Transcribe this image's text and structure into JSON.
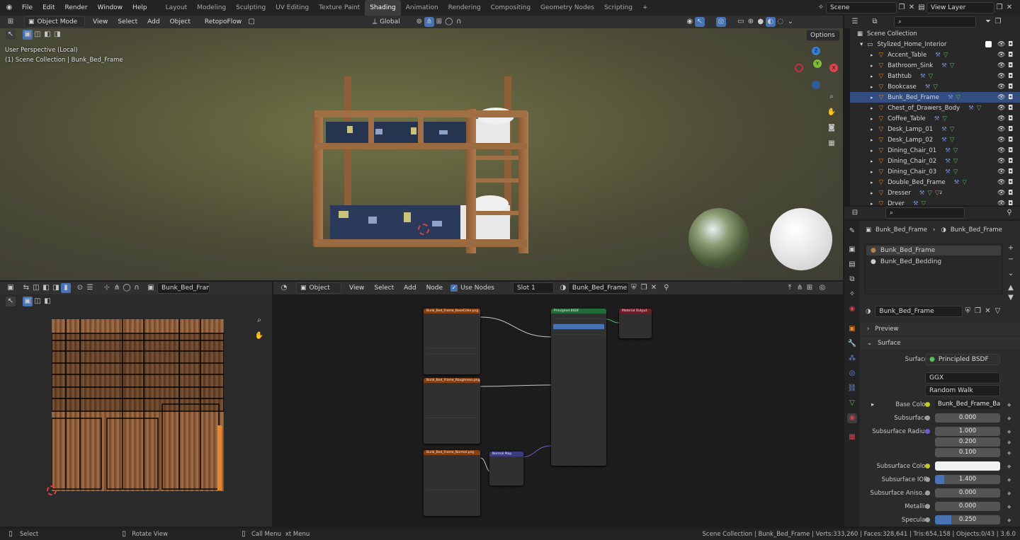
{
  "menu": [
    "File",
    "Edit",
    "Render",
    "Window",
    "Help"
  ],
  "workspaces": [
    "Layout",
    "Modeling",
    "Sculpting",
    "UV Editing",
    "Texture Paint",
    "Shading",
    "Animation",
    "Rendering",
    "Compositing",
    "Geometry Nodes",
    "Scripting"
  ],
  "active_workspace": "Shading",
  "scene": "Scene",
  "view_layer": "View Layer",
  "viewport_header": {
    "mode": "Object Mode",
    "menus": [
      "View",
      "Select",
      "Add",
      "Object"
    ],
    "addon": "RetopoFlow",
    "transform": "Global",
    "options": "Options"
  },
  "viewport_overlay": {
    "perspective": "User Perspective (Local)",
    "collection": "(1) Scene Collection | Bunk_Bed_Frame"
  },
  "gizmo": {
    "x": "X",
    "y": "Y",
    "z": "Z"
  },
  "outliner": {
    "root": "Scene Collection",
    "collection": "Stylized_Home_Interior",
    "items": [
      "Accent_Table",
      "Bathroom_Sink",
      "Bathtub",
      "Bookcase",
      "Bunk_Bed_Frame",
      "Chest_of_Drawers_Body",
      "Coffee_Table",
      "Desk_Lamp_01",
      "Desk_Lamp_02",
      "Dining_Chair_01",
      "Dining_Chair_02",
      "Dining_Chair_03",
      "Double_Bed_Frame",
      "Dresser",
      "Dryer"
    ],
    "dresser_count": "2"
  },
  "properties": {
    "breadcrumb_object": "Bunk_Bed_Frame",
    "breadcrumb_material": "Bunk_Bed_Frame",
    "slots": [
      "Bunk_Bed_Frame",
      "Bunk_Bed_Bedding"
    ],
    "material_name": "Bunk_Bed_Frame",
    "preview_label": "Preview",
    "surface_panel": "Surface",
    "surface_label": "Surface",
    "surface_value": "Principled BSDF",
    "distribution": "GGX",
    "subsurface_method": "Random Walk",
    "fields": [
      {
        "label": "Base Color",
        "value": "Bunk_Bed_Frame_Bas..."
      },
      {
        "label": "Subsurface",
        "value": "0.000"
      },
      {
        "label": "Subsurface Radius",
        "value": "1.000"
      },
      {
        "label": "",
        "value": "0.200"
      },
      {
        "label": "",
        "value": "0.100"
      },
      {
        "label": "Subsurface Color",
        "value": ""
      },
      {
        "label": "Subsurface IOR",
        "value": "1.400"
      },
      {
        "label": "Subsurface Aniso...",
        "value": "0.000"
      },
      {
        "label": "Metallic",
        "value": "0.000"
      },
      {
        "label": "Specular",
        "value": "0.250"
      }
    ]
  },
  "uv_header": {
    "image": "Bunk_Bed_Frame_I"
  },
  "node_header": {
    "type": "Object",
    "menus": [
      "View",
      "Select",
      "Add",
      "Node"
    ],
    "use_nodes": "Use Nodes",
    "slot": "Slot 1",
    "material": "Bunk_Bed_Frame"
  },
  "nodes": {
    "tex1": "Bunk_Bed_Frame_BaseColor.png",
    "tex2": "Bunk_Bed_Frame_Roughness.png",
    "tex3": "Bunk_Bed_Frame_Normal.png",
    "bsdf": "Principled BSDF",
    "output": "Material Output",
    "normal_map": "Normal Map"
  },
  "status": {
    "left": "Select",
    "mid": "Rotate View",
    "menu": "Call Menu",
    "ctx": "xt Menu",
    "stats": "Scene Collection | Bunk_Bed_Frame | Verts:333,260 | Faces:328,641 | Tris:654,158 | Objects:0/43 | 3.6.0"
  },
  "colors": {
    "accent": "#4772b3",
    "object_orange": "#e8862a",
    "modifier_blue": "#6b8fd8",
    "mesh_green": "#53c25a"
  }
}
